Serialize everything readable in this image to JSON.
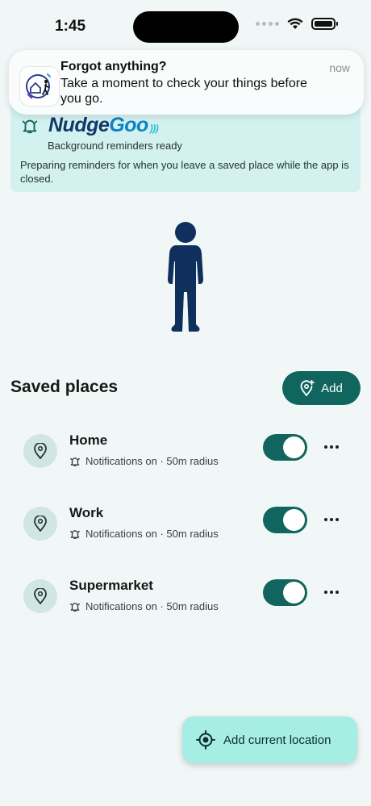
{
  "status_bar": {
    "time": "1:45"
  },
  "notification": {
    "title": "Forgot anything?",
    "body": "Take a moment to check your things before you go.",
    "time": "now",
    "app_icon": "nudgegoo-app-icon"
  },
  "info_card": {
    "brand_left": "Nudge",
    "brand_right": "Goo",
    "subtitle": "Background reminders ready",
    "description": "Preparing reminders for when you leave a saved place while the app is closed."
  },
  "saved_places": {
    "title": "Saved places",
    "add_label": "Add",
    "items": [
      {
        "name": "Home",
        "meta": "Notifications on · 50m radius",
        "enabled": true
      },
      {
        "name": "Work",
        "meta": "Notifications on · 50m radius",
        "enabled": true
      },
      {
        "name": "Supermarket",
        "meta": "Notifications on · 50m radius",
        "enabled": true
      }
    ]
  },
  "fab": {
    "label": "Add current location"
  },
  "colors": {
    "background": "#f1f7f6",
    "accent": "#10665e",
    "card": "#d3f1ef",
    "fab": "#a6eee4",
    "figure": "#0f2f5c"
  }
}
